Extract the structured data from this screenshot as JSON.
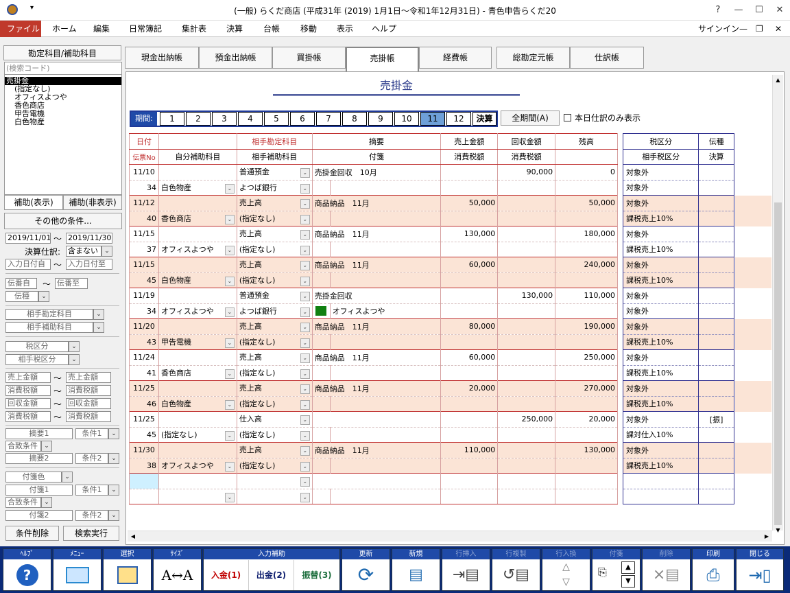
{
  "window": {
    "title": "(一般) らくだ商店 (平成31年 (2019) 1月1日～令和1年12月31日) - 青色申告らくだ20",
    "help": "?",
    "min": "—",
    "max": "☐",
    "close": "✕",
    "signin": "サインイン"
  },
  "menu": [
    "ファイル",
    "ホーム",
    "編集",
    "日常簿記",
    "集計表",
    "決算",
    "台帳",
    "移動",
    "表示",
    "ヘルプ"
  ],
  "sidebar": {
    "header": "勘定科目/補助科目",
    "search_placeholder": "(検索コード)",
    "tree": [
      "売掛金",
      "(指定なし)",
      "オフィスよつや",
      "香色商店",
      "甲告電機",
      "白色物産"
    ],
    "btn_show": "補助(表示)",
    "btn_hide": "補助(非表示)",
    "other": "その他の条件...",
    "date_from": "2019/11/01",
    "tilde": "～",
    "date_to": "2019/11/30",
    "kessan_label": "決算仕訳:",
    "kessan_val": "含まない",
    "nyuryoku_from": "入力日付自",
    "nyuryoku_to": "入力日付至",
    "den_from": "伝番自",
    "den_to": "伝番至",
    "denshu": "伝種",
    "aite": "相手勘定科目",
    "aite_hojo": "相手補助科目",
    "zei": "税区分",
    "aite_zei": "相手税区分",
    "uri_from": "売上金額",
    "uri_to": "売上金額",
    "shohi_from": "消費税額",
    "shohi_to": "消費税額",
    "kai_from": "回収金額",
    "kai_to": "回収金額",
    "shohi2_from": "消費税額",
    "shohi2_to": "消費税額",
    "tekiyo1": "摘要1",
    "joken1": "条件1",
    "gouchi1": "合致条件",
    "tekiyo2": "摘要2",
    "joken2": "条件2",
    "fusen_color": "付箋色",
    "fusen1": "付箋1",
    "fjoken1": "条件1",
    "fgouchi": "合致条件",
    "fusen2": "付箋2",
    "fjoken2": "条件2",
    "clear": "条件削除",
    "search": "検索実行"
  },
  "tabs": [
    "現金出納帳",
    "預金出納帳",
    "買掛帳",
    "売掛帳",
    "経費帳",
    "総勘定元帳",
    "仕訳帳"
  ],
  "ledger_title": "売掛金",
  "period": {
    "label": "期間:",
    "months": [
      "1",
      "2",
      "3",
      "4",
      "5",
      "6",
      "7",
      "8",
      "9",
      "10",
      "11",
      "12",
      "決算"
    ],
    "selected": "11",
    "all": "全期間(A)",
    "today_only": "本日仕訳のみ表示"
  },
  "headers": {
    "date": "日付",
    "den": "伝票No",
    "acct": "相手勘定科目",
    "self_sub": "自分補助科目",
    "aite_sub": "相手補助科目",
    "tekiyo": "摘要",
    "fusen": "付箋",
    "uri": "売上金額",
    "shohi": "消費税額",
    "kaishu": "回収金額",
    "shohi2": "消費税額",
    "zandaka": "残高",
    "zei": "税区分",
    "aite_zei": "相手税区分",
    "denshu": "伝種",
    "kessan": "決算"
  },
  "rows": [
    {
      "date": "11/10",
      "den": "34",
      "sub": "白色物産",
      "acct": "普通預金",
      "asub": "よつば銀行",
      "tekiyo": "売掛金回収　10月",
      "fusen": "",
      "uri": "",
      "kai": "90,000",
      "zan": "0",
      "zei": "対象外",
      "azei": "対象外",
      "shu": "",
      "pink": false
    },
    {
      "date": "11/12",
      "den": "40",
      "sub": "香色商店",
      "acct": "売上高",
      "asub": "(指定なし)",
      "tekiyo": "商品納品　11月",
      "fusen": "",
      "uri": "50,000",
      "kai": "",
      "zan": "50,000",
      "zei": "対象外",
      "azei": "課税売上10%",
      "shu": "",
      "pink": true
    },
    {
      "date": "11/15",
      "den": "37",
      "sub": "オフィスよつや",
      "acct": "売上高",
      "asub": "(指定なし)",
      "tekiyo": "商品納品　11月",
      "fusen": "",
      "uri": "130,000",
      "kai": "",
      "zan": "180,000",
      "zei": "対象外",
      "azei": "課税売上10%",
      "shu": "",
      "pink": false
    },
    {
      "date": "11/15",
      "den": "45",
      "sub": "白色物産",
      "acct": "売上高",
      "asub": "(指定なし)",
      "tekiyo": "商品納品　11月",
      "fusen": "",
      "uri": "60,000",
      "kai": "",
      "zan": "240,000",
      "zei": "対象外",
      "azei": "課税売上10%",
      "shu": "",
      "pink": true
    },
    {
      "date": "11/19",
      "den": "34",
      "sub": "オフィスよつや",
      "acct": "普通預金",
      "asub": "よつば銀行",
      "tekiyo": "売掛金回収",
      "fusen": "オフィスよつや",
      "uri": "",
      "kai": "130,000",
      "zan": "110,000",
      "zei": "対象外",
      "azei": "対象外",
      "shu": "",
      "pink": false
    },
    {
      "date": "11/20",
      "den": "43",
      "sub": "甲告電機",
      "acct": "売上高",
      "asub": "(指定なし)",
      "tekiyo": "商品納品　11月",
      "fusen": "",
      "uri": "80,000",
      "kai": "",
      "zan": "190,000",
      "zei": "対象外",
      "azei": "課税売上10%",
      "shu": "",
      "pink": true
    },
    {
      "date": "11/24",
      "den": "41",
      "sub": "香色商店",
      "acct": "売上高",
      "asub": "(指定なし)",
      "tekiyo": "商品納品　11月",
      "fusen": "",
      "uri": "60,000",
      "kai": "",
      "zan": "250,000",
      "zei": "対象外",
      "azei": "課税売上10%",
      "shu": "",
      "pink": false
    },
    {
      "date": "11/25",
      "den": "46",
      "sub": "白色物産",
      "acct": "売上高",
      "asub": "(指定なし)",
      "tekiyo": "商品納品　11月",
      "fusen": "",
      "uri": "20,000",
      "kai": "",
      "zan": "270,000",
      "zei": "対象外",
      "azei": "課税売上10%",
      "shu": "",
      "pink": true
    },
    {
      "date": "11/25",
      "den": "45",
      "sub": "(指定なし)",
      "acct": "仕入高",
      "asub": "(指定なし)",
      "tekiyo": "",
      "fusen": "",
      "uri": "",
      "kai": "250,000",
      "zan": "20,000",
      "zei": "対象外",
      "azei": "課対仕入10%",
      "shu": "[振]",
      "pink": false
    },
    {
      "date": "11/30",
      "den": "38",
      "sub": "オフィスよつや",
      "acct": "売上高",
      "asub": "(指定なし)",
      "tekiyo": "商品納品　11月",
      "fusen": "",
      "uri": "110,000",
      "kai": "",
      "zan": "130,000",
      "zei": "対象外",
      "azei": "課税売上10%",
      "shu": "",
      "pink": true
    }
  ],
  "toolbar": {
    "help": "ﾍﾙﾌﾟ",
    "menu": "ﾒﾆｭｰ",
    "select": "選択",
    "size": "ｻｲｽﾞ",
    "input_help": "入力補助",
    "nyukin": "入金(1)",
    "shukkin": "出金(2)",
    "furikae": "振替(3)",
    "update": "更新",
    "new": "新規",
    "row_ins": "行挿入",
    "row_copy": "行複製",
    "row_swap": "行入換",
    "fusen": "付箋",
    "delete": "削除",
    "print": "印刷",
    "close": "閉じる"
  },
  "colors": {
    "menu_active": "#c0392b",
    "toolbar": "#0a2a78",
    "pink": "#fbe4d6",
    "period_sel": "#6ea0d8"
  }
}
